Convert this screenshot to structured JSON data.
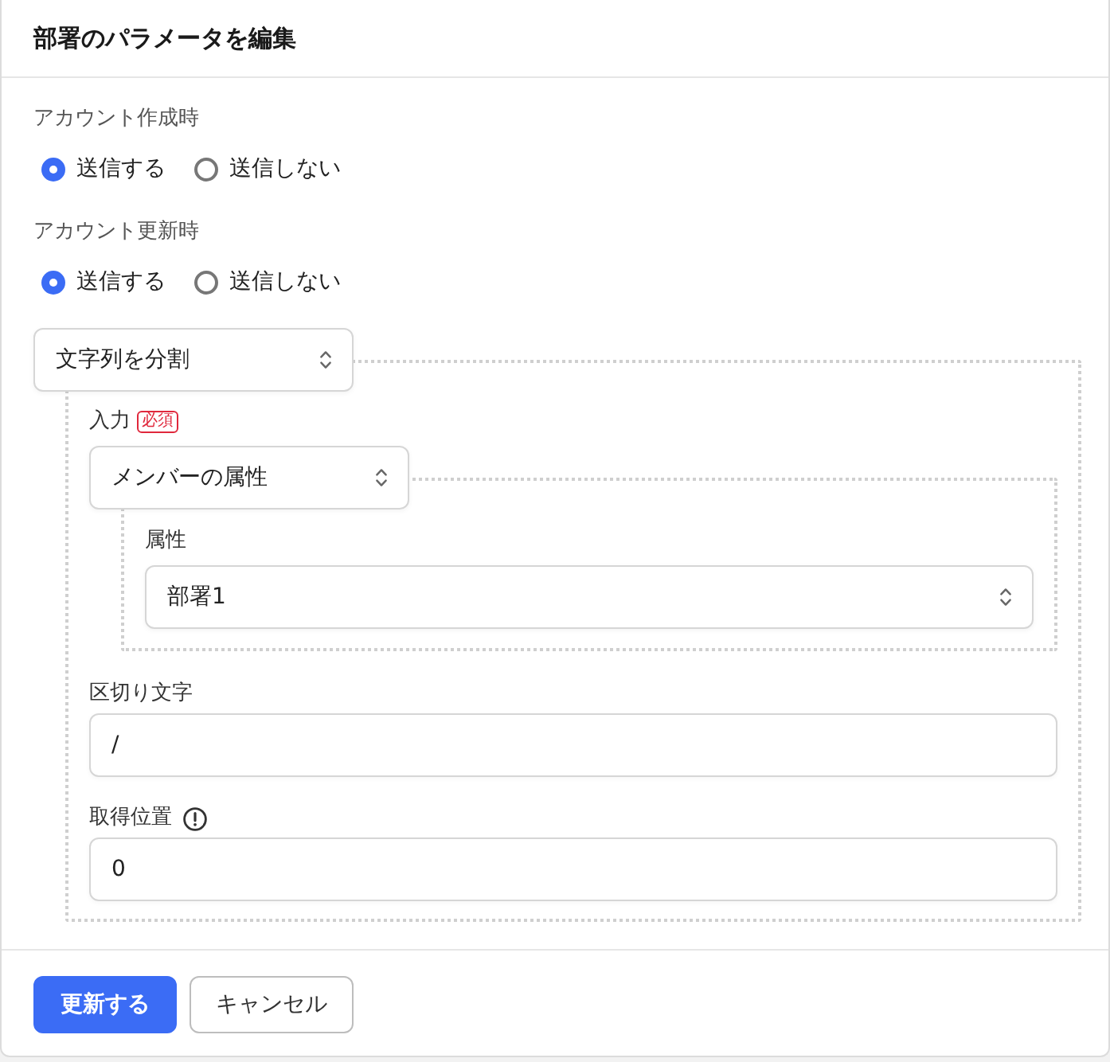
{
  "dialog": {
    "title": "部署のパラメータを編集"
  },
  "sections": [
    {
      "label": "アカウント作成時",
      "options": [
        {
          "label": "送信する",
          "selected": true
        },
        {
          "label": "送信しない",
          "selected": false
        }
      ]
    },
    {
      "label": "アカウント更新時",
      "options": [
        {
          "label": "送信する",
          "selected": true
        },
        {
          "label": "送信しない",
          "selected": false
        }
      ]
    }
  ],
  "transform": {
    "select": {
      "value": "文字列を分割"
    },
    "input": {
      "label": "入力",
      "badge": "必須",
      "select": {
        "value": "メンバーの属性"
      },
      "attribute": {
        "label": "属性",
        "select": {
          "value": "部署1"
        }
      }
    },
    "fields": [
      {
        "label": "区切り文字",
        "value": "/"
      },
      {
        "label": "取得位置",
        "value": "0",
        "info": true
      }
    ]
  },
  "buttons": [
    {
      "label": "更新する",
      "kind": "primary"
    },
    {
      "label": "キャンセル",
      "kind": "secondary"
    }
  ]
}
